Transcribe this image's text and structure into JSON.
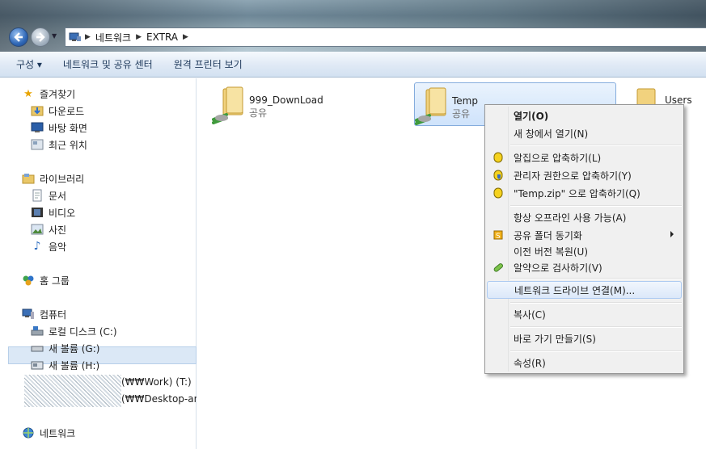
{
  "address": {
    "segments": [
      "네트워크",
      "EXTRA"
    ]
  },
  "toolbar": {
    "organize": "구성 ▾",
    "network_center": "네트워크 및 공유 센터",
    "remote_printers": "원격 프린터 보기"
  },
  "sidebar": {
    "favorites": "즐겨찾기",
    "downloads": "다운로드",
    "desktop": "바탕 화면",
    "recent": "최근 위치",
    "libraries": "라이브러리",
    "documents": "문서",
    "videos": "비디오",
    "pictures": "사진",
    "music": "음악",
    "homegroup": "홈 그룹",
    "computer": "컴퓨터",
    "local_disk": "로컬 디스크 (C:)",
    "vol_g": "새 볼륨 (G:)",
    "vol_h": "새 볼륨 (H:)",
    "work_drive": "(₩₩Work) (T:)",
    "desktop_drive": "(₩₩Desktop-ami!",
    "network": "네트워크"
  },
  "content": {
    "items": [
      {
        "name": "999_DownLoad",
        "sub": "공유"
      },
      {
        "name": "Temp",
        "sub": "공유"
      },
      {
        "name": "Users",
        "sub": ""
      }
    ]
  },
  "menu": {
    "open": "열기(O)",
    "open_new": "새 창에서 열기(N)",
    "alzip": "알집으로 압축하기(L)",
    "admin_zip": "관리자 권한으로 압축하기(Y)",
    "zip_temp": "\"Temp.zip\" 으로 압축하기(Q)",
    "offline": "항상 오프라인 사용 가능(A)",
    "sync": "공유 폴더 동기화",
    "restore": "이전 버전 복원(U)",
    "scan": "알약으로 검사하기(V)",
    "map_drive": "네트워크 드라이브 연결(M)...",
    "copy": "복사(C)",
    "shortcut": "바로 가기 만들기(S)",
    "properties": "속성(R)"
  }
}
